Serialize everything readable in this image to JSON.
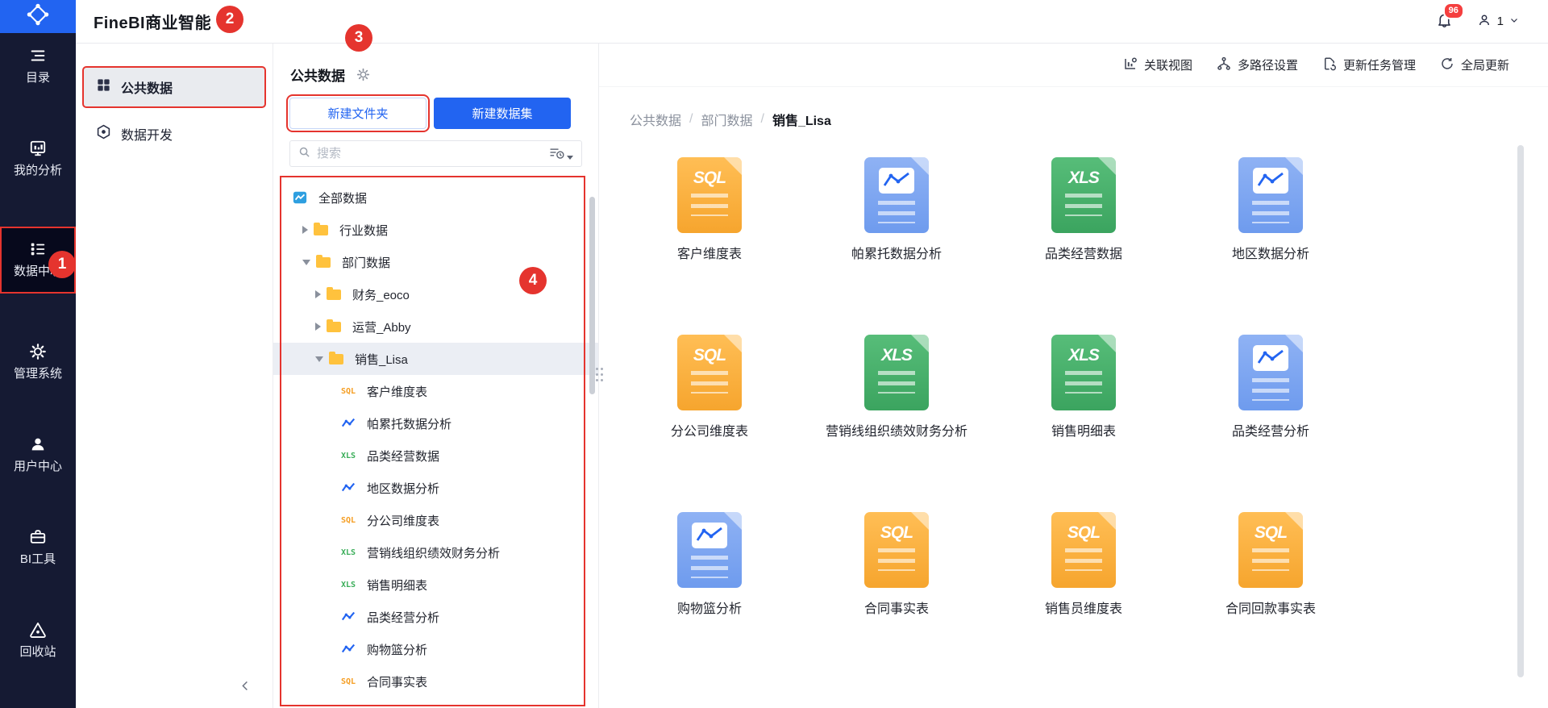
{
  "topbar": {
    "app_title": "FineBI商业智能",
    "notification_count": "96",
    "user_label": "1"
  },
  "sidebar": {
    "items": [
      {
        "label": "目录"
      },
      {
        "label": "我的分析"
      },
      {
        "label": "数据中心",
        "active": true
      },
      {
        "label": "管理系统"
      },
      {
        "label": "用户中心"
      },
      {
        "label": "BI工具"
      },
      {
        "label": "回收站"
      }
    ]
  },
  "nav_panel": {
    "items": [
      {
        "label": "公共数据",
        "active": true
      },
      {
        "label": "数据开发",
        "active": false
      }
    ]
  },
  "data_panel": {
    "title": "公共数据",
    "buttons": {
      "new_folder": "新建文件夹",
      "new_dataset": "新建数据集"
    },
    "search_placeholder": "搜索",
    "tree": [
      {
        "label": "全部数据",
        "level": 0,
        "icon": "all"
      },
      {
        "label": "行业数据",
        "level": 1,
        "icon": "folder",
        "arrow": "right"
      },
      {
        "label": "部门数据",
        "level": 1,
        "icon": "folder",
        "arrow": "down"
      },
      {
        "label": "财务_eoco",
        "level": 2,
        "icon": "folder",
        "arrow": "right"
      },
      {
        "label": "运营_Abby",
        "level": 2,
        "icon": "folder",
        "arrow": "right"
      },
      {
        "label": "销售_Lisa",
        "level": 2,
        "icon": "folder",
        "arrow": "down",
        "selected": true
      },
      {
        "label": "客户维度表",
        "level": 3,
        "icon": "sql"
      },
      {
        "label": "帕累托数据分析",
        "level": 3,
        "icon": "chart"
      },
      {
        "label": "品类经营数据",
        "level": 3,
        "icon": "xls"
      },
      {
        "label": "地区数据分析",
        "level": 3,
        "icon": "chart"
      },
      {
        "label": "分公司维度表",
        "level": 3,
        "icon": "sql"
      },
      {
        "label": "营销线组织绩效财务分析",
        "level": 3,
        "icon": "xls"
      },
      {
        "label": "销售明细表",
        "level": 3,
        "icon": "xls"
      },
      {
        "label": "品类经营分析",
        "level": 3,
        "icon": "chart"
      },
      {
        "label": "购物篮分析",
        "level": 3,
        "icon": "chart"
      },
      {
        "label": "合同事实表",
        "level": 3,
        "icon": "sql"
      }
    ]
  },
  "main": {
    "toolbar": [
      {
        "label": "关联视图"
      },
      {
        "label": "多路径设置"
      },
      {
        "label": "更新任务管理"
      },
      {
        "label": "全局更新"
      }
    ],
    "breadcrumb": {
      "items": [
        "公共数据",
        "部门数据"
      ],
      "current": "销售_Lisa",
      "separator": "/"
    },
    "cards": [
      {
        "label": "客户维度表",
        "type": "sql"
      },
      {
        "label": "帕累托数据分析",
        "type": "chart"
      },
      {
        "label": "品类经营数据",
        "type": "xls"
      },
      {
        "label": "地区数据分析",
        "type": "chart"
      },
      {
        "label": "分公司维度表",
        "type": "sql"
      },
      {
        "label": "营销线组织绩效财务分析",
        "type": "xls"
      },
      {
        "label": "销售明细表",
        "type": "xls"
      },
      {
        "label": "品类经营分析",
        "type": "chart"
      },
      {
        "label": "购物篮分析",
        "type": "chart"
      },
      {
        "label": "合同事实表",
        "type": "sql"
      },
      {
        "label": "销售员维度表",
        "type": "sql"
      },
      {
        "label": "合同回款事实表",
        "type": "sql"
      }
    ]
  },
  "file_types": {
    "sql": "SQL",
    "xls": "XLS"
  },
  "annotations": {
    "markers": [
      "1",
      "2",
      "3",
      "4"
    ]
  },
  "colors": {
    "brand_blue": "#2264F1",
    "sidebar_bg": "#151A33",
    "annotation_red": "#E5342E",
    "badge_red": "#F53F3F",
    "folder_yellow": "#FFC23D",
    "sql_orange": "#F59E22",
    "xls_green": "#3BAE5A",
    "chart_doc_blue": "#7FA7F0"
  }
}
